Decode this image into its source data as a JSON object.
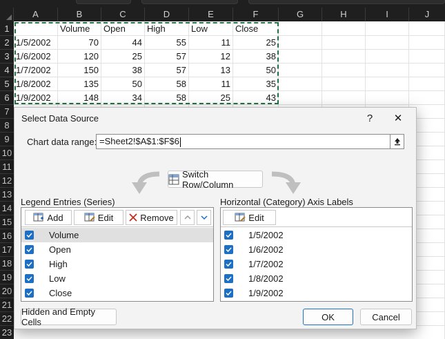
{
  "columns": [
    "A",
    "B",
    "C",
    "D",
    "E",
    "F",
    "G",
    "H",
    "I",
    "J"
  ],
  "rows": [
    "1",
    "2",
    "3",
    "4",
    "5",
    "6",
    "7",
    "8",
    "9",
    "10",
    "11",
    "12",
    "13",
    "14",
    "15",
    "16",
    "17",
    "18",
    "19",
    "20",
    "21",
    "22",
    "23"
  ],
  "sheet": {
    "headers": [
      "",
      "Volume",
      "Open",
      "High",
      "Low",
      "Close"
    ],
    "data": [
      [
        "1/5/2002",
        "70",
        "44",
        "55",
        "11",
        "25"
      ],
      [
        "1/6/2002",
        "120",
        "25",
        "57",
        "12",
        "38"
      ],
      [
        "1/7/2002",
        "150",
        "38",
        "57",
        "13",
        "50"
      ],
      [
        "1/8/2002",
        "135",
        "50",
        "58",
        "11",
        "35"
      ],
      [
        "1/9/2002",
        "148",
        "34",
        "58",
        "25",
        "43"
      ]
    ]
  },
  "dialog": {
    "title": "Select Data Source",
    "help": "?",
    "close": "✕",
    "range_label": "Chart data range:",
    "range_value": "=Sheet2!$A$1:$F$6",
    "switch_label": "Switch Row/Column",
    "legend_label": "Legend Entries (Series)",
    "axis_label": "Horizontal (Category) Axis Labels",
    "add": "Add",
    "edit": "Edit",
    "remove": "Remove",
    "axis_edit": "Edit",
    "series": [
      "Volume",
      "Open",
      "High",
      "Low",
      "Close"
    ],
    "categories": [
      "1/5/2002",
      "1/6/2002",
      "1/7/2002",
      "1/8/2002",
      "1/9/2002"
    ],
    "hidden_cells": "Hidden and Empty Cells",
    "ok": "OK",
    "cancel": "Cancel"
  },
  "colors": {
    "accent": "#1c6fc4",
    "selection": "#217346",
    "app_bg": "#1f1f1f"
  }
}
